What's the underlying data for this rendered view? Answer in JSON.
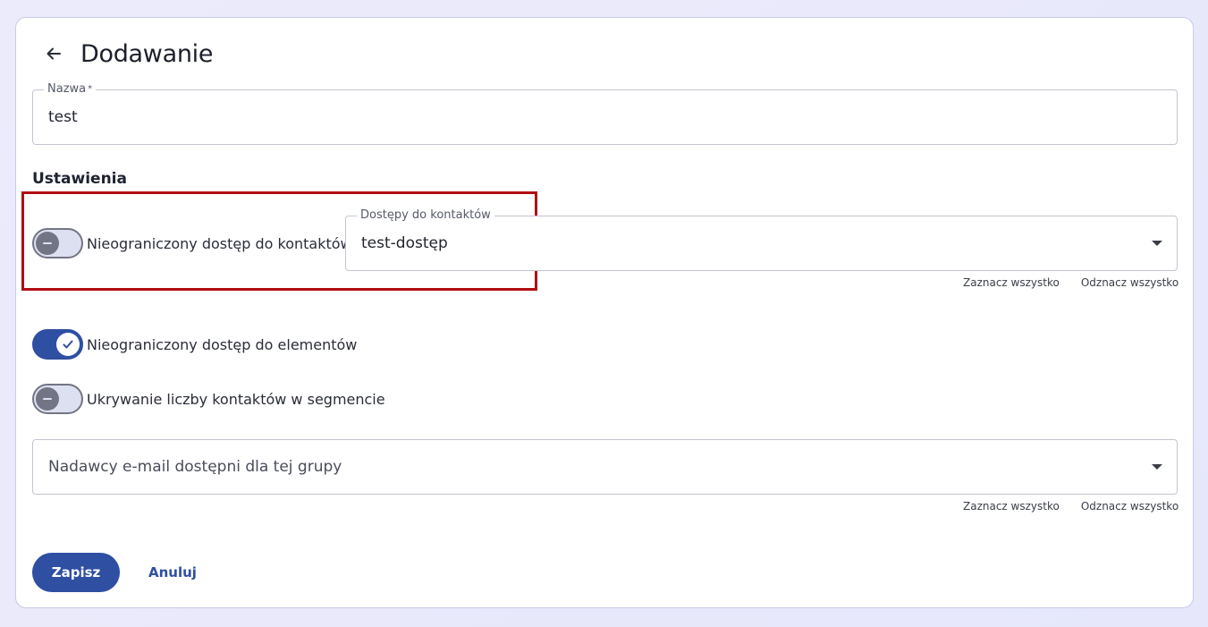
{
  "header": {
    "title": "Dodawanie",
    "back_icon": "arrow-left-icon"
  },
  "name_field": {
    "label": "Nazwa",
    "required_mark": "*",
    "value": "test"
  },
  "settings": {
    "title": "Ustawienia",
    "unlimited_contacts": {
      "label": "Nieograniczony dostęp do kontaktów",
      "checked": false
    },
    "contact_access": {
      "label": "Dostępy do kontaktów",
      "value": "test-dostęp",
      "select_all": "Zaznacz wszystko",
      "deselect_all": "Odznacz wszystko"
    },
    "unlimited_elements": {
      "label": "Nieograniczony dostęp do elementów",
      "checked": true
    },
    "hide_segment_count": {
      "label": "Ukrywanie liczby kontaktów w segmencie",
      "checked": false
    },
    "senders": {
      "placeholder": "Nadawcy e-mail dostępni dla tej grupy",
      "select_all": "Zaznacz wszystko",
      "deselect_all": "Odznacz wszystko"
    }
  },
  "actions": {
    "save": "Zapisz",
    "cancel": "Anuluj"
  },
  "colors": {
    "primary": "#2f4fa3",
    "highlight": "#b00d13"
  }
}
